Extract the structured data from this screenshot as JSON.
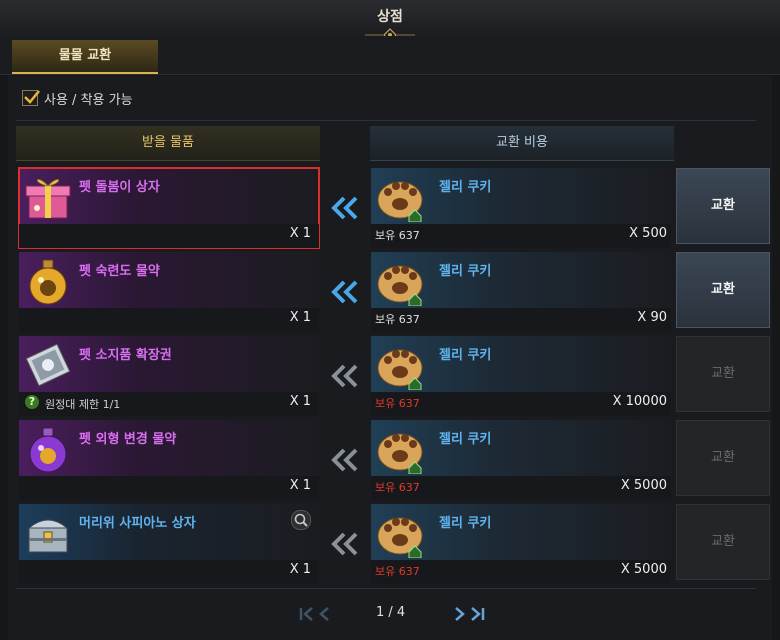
{
  "window": {
    "title": "상점"
  },
  "tab": {
    "label": "물물 교환"
  },
  "filter": {
    "label": "사용 / 착용 가능",
    "checked": true
  },
  "columns": {
    "receive": "받을 물품",
    "cost": "교환 비용"
  },
  "rows": [
    {
      "name": "펫 돌봄이 상자",
      "qty": "X 1",
      "limit": "",
      "cost_name": "젤리 쿠키",
      "owned": "보유 637",
      "owned_red": false,
      "cost_qty": "X 500",
      "button": "교환",
      "enabled": true,
      "selected": true,
      "color": "purple",
      "icon": "gift-box-icon"
    },
    {
      "name": "펫 숙련도 물약",
      "qty": "X 1",
      "limit": "",
      "cost_name": "젤리 쿠키",
      "owned": "보유 637",
      "owned_red": false,
      "cost_qty": "X 90",
      "button": "교환",
      "enabled": true,
      "selected": false,
      "color": "purple",
      "icon": "potion-icon"
    },
    {
      "name": "펫 소지품 확장권",
      "qty": "X 1",
      "limit": "원정대 제한 1/1",
      "cost_name": "젤리 쿠키",
      "owned": "보유 637",
      "owned_red": true,
      "cost_qty": "X 10000",
      "button": "교환",
      "enabled": false,
      "selected": false,
      "color": "purple",
      "icon": "ticket-icon"
    },
    {
      "name": "펫 외형 변경 물약",
      "qty": "X 1",
      "limit": "",
      "cost_name": "젤리 쿠키",
      "owned": "보유 637",
      "owned_red": true,
      "cost_qty": "X 5000",
      "button": "교환",
      "enabled": false,
      "selected": false,
      "color": "purple",
      "icon": "potion-icon"
    },
    {
      "name": "머리위 사피아노 상자",
      "qty": "X 1",
      "limit": "",
      "cost_name": "젤리 쿠키",
      "owned": "보유 637",
      "owned_red": true,
      "cost_qty": "X 5000",
      "button": "교환",
      "enabled": false,
      "selected": false,
      "color": "blue",
      "icon": "chest-icon"
    }
  ],
  "pager": {
    "text": "1 / 4"
  },
  "colors": {
    "accent": "#d8b34a",
    "purple": "#d86ef0",
    "blue": "#5fb4f0",
    "red": "#e23a2a"
  }
}
